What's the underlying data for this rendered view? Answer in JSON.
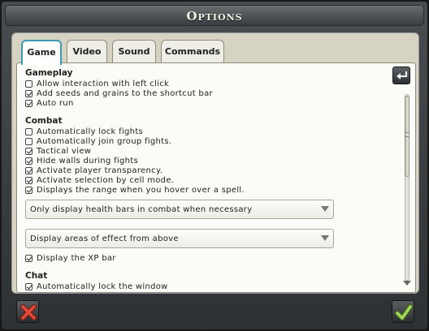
{
  "window": {
    "title": "Options"
  },
  "tabs": [
    {
      "label": "Game",
      "active": true
    },
    {
      "label": "Video",
      "active": false
    },
    {
      "label": "Sound",
      "active": false
    },
    {
      "label": "Commands",
      "active": false
    }
  ],
  "sections": {
    "gameplay": {
      "title": "Gameplay",
      "items": [
        {
          "label": "Allow interaction with left click",
          "checked": false
        },
        {
          "label": "Add seeds and grains to the shortcut bar",
          "checked": true
        },
        {
          "label": "Auto run",
          "checked": true
        }
      ]
    },
    "combat": {
      "title": "Combat",
      "items": [
        {
          "label": "Automatically lock fights",
          "checked": false
        },
        {
          "label": "Automatically join group fights.",
          "checked": false
        },
        {
          "label": "Tactical view",
          "checked": true
        },
        {
          "label": "Hide walls during fights",
          "checked": true
        },
        {
          "label": "Activate player transparency.",
          "checked": true
        },
        {
          "label": "Activate selection by cell mode.",
          "checked": true
        },
        {
          "label": "Displays the range when you hover over a spell.",
          "checked": true
        }
      ],
      "health_bars_select": "Only display health bars in combat when necessary",
      "aoe_select": "Display areas of effect from above",
      "xp_bar": {
        "label": "Display the XP bar",
        "checked": true
      }
    },
    "chat": {
      "title": "Chat",
      "items": [
        {
          "label": "Automatically lock the window",
          "checked": true
        }
      ]
    }
  },
  "icons": {
    "back": "return-arrow-icon",
    "cancel": "close-x-icon",
    "confirm": "checkmark-icon"
  },
  "colors": {
    "active_tab_border": "#3a9bb3",
    "cancel_red": "#c0392b",
    "confirm_green": "#8bc34a"
  }
}
